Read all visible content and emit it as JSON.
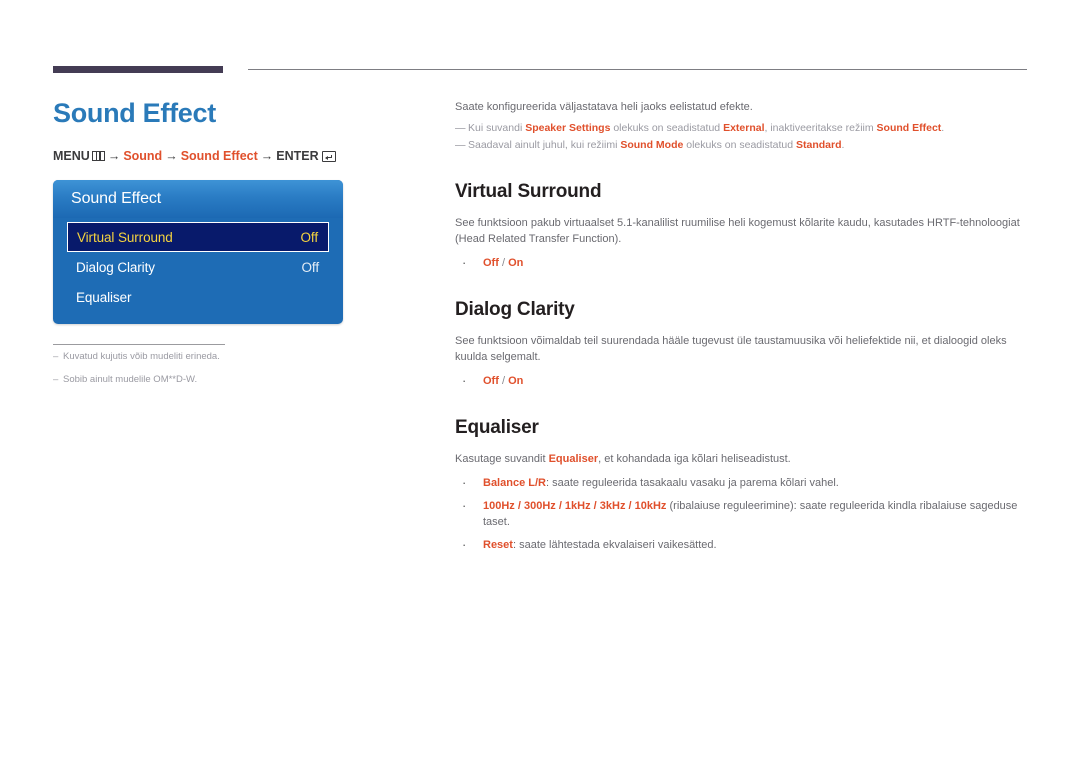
{
  "page": {
    "title": "Sound Effect",
    "title_color": "#2a7ab9",
    "accent_color": "#e0502c",
    "rule_color": "#443c54"
  },
  "breadcrumb": {
    "menu_label": "MENU",
    "menu_icon": "menu-bars-icon",
    "arrow": "→",
    "step1": "Sound",
    "step2": "Sound Effect",
    "enter_label": "ENTER",
    "enter_icon": "enter-return-icon"
  },
  "osd": {
    "header": "Sound Effect",
    "rows": [
      {
        "label": "Virtual Surround",
        "value": "Off",
        "selected": true
      },
      {
        "label": "Dialog Clarity",
        "value": "Off",
        "selected": false
      },
      {
        "label": "Equaliser",
        "value": "",
        "selected": false
      }
    ]
  },
  "panel_footnotes": [
    {
      "dash": "–",
      "text": "Kuvatud kujutis võib mudeliti erineda."
    },
    {
      "dash": "–",
      "text": "Sobib ainult mudelile OM**D-W."
    }
  ],
  "intro": {
    "text": "Saate konfigureerida väljastatava heli jaoks eelistatud efekte."
  },
  "notes": [
    {
      "dash": "—",
      "parts": [
        {
          "t": "Kui suvandi ",
          "b": false
        },
        {
          "t": "Speaker Settings",
          "b": true
        },
        {
          "t": " olekuks on seadistatud ",
          "b": false
        },
        {
          "t": "External",
          "b": true
        },
        {
          "t": ", inaktiveeritakse režiim ",
          "b": false
        },
        {
          "t": "Sound Effect",
          "b": true
        },
        {
          "t": ".",
          "b": false
        }
      ]
    },
    {
      "dash": "—",
      "parts": [
        {
          "t": "Saadaval ainult juhul, kui režiimi ",
          "b": false
        },
        {
          "t": "Sound Mode",
          "b": true
        },
        {
          "t": " olekuks on seadistatud ",
          "b": false
        },
        {
          "t": "Standard",
          "b": true
        },
        {
          "t": ".",
          "b": false
        }
      ]
    }
  ],
  "sections": [
    {
      "heading": "Virtual Surround",
      "body": "See funktsioon pakub virtuaalset 5.1-kanalilist ruumilise heli kogemust kõlarite kaudu, kasutades HRTF-tehnoloogiat (Head Related Transfer Function).",
      "options_bullet": {
        "dot": "·",
        "opt1": "Off",
        "sep": " / ",
        "opt2": "On"
      }
    },
    {
      "heading": "Dialog Clarity",
      "body": "See funktsioon võimaldab teil suurendada hääle tugevust üle taustamuusika või heliefektide nii, et dialoogid oleks kuulda selgemalt.",
      "options_bullet": {
        "dot": "·",
        "opt1": "Off",
        "sep": " / ",
        "opt2": "On"
      }
    }
  ],
  "equaliser": {
    "heading": "Equaliser",
    "intro_pre": "Kasutage suvandit ",
    "intro_term": "Equaliser",
    "intro_post": ", et kohandada iga kõlari heliseadistust.",
    "items": [
      {
        "dot": "·",
        "term": "Balance L/R",
        "desc": ": saate reguleerida tasakaalu vasaku ja parema kõlari vahel."
      },
      {
        "dot": "·",
        "term": "100Hz / 300Hz / 1kHz / 3kHz / 10kHz",
        "desc": " (ribalaiuse reguleerimine): saate reguleerida kindla ribalaiuse sageduse taset."
      },
      {
        "dot": "·",
        "term": "Reset",
        "desc": ": saate lähtestada ekvalaiseri vaikesätted."
      }
    ]
  }
}
